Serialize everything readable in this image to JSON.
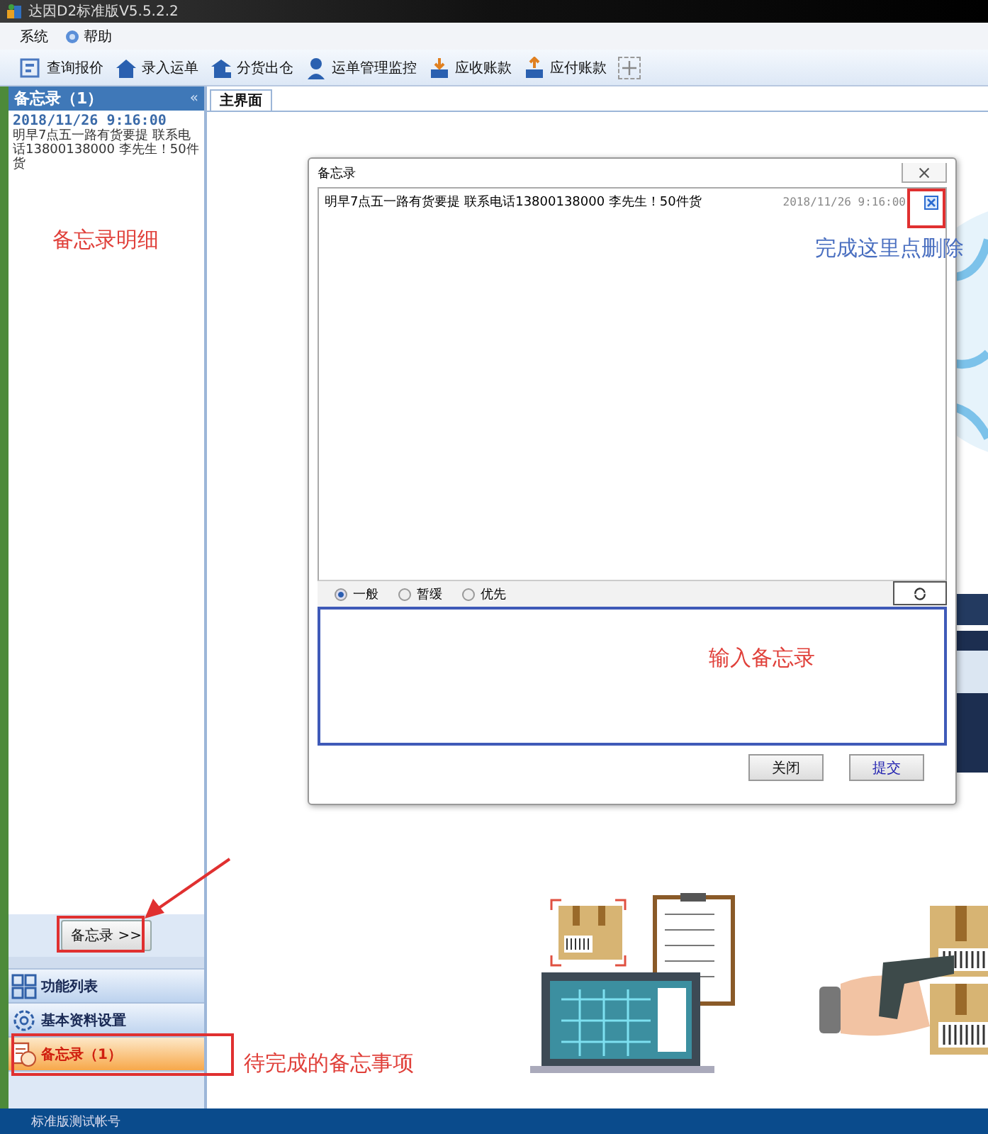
{
  "window": {
    "title": "达因D2标准版V5.5.2.2"
  },
  "menu": [
    {
      "label": "系统",
      "kind": "plain"
    },
    {
      "label": "帮助",
      "kind": "help"
    }
  ],
  "toolbar": [
    {
      "label": "查询报价",
      "kind": "quote"
    },
    {
      "label": "录入运单",
      "kind": "house"
    },
    {
      "label": "分货出仓",
      "kind": "warehouse"
    },
    {
      "label": "运单管理监控",
      "kind": "person"
    },
    {
      "label": "应收账款",
      "kind": "receive"
    },
    {
      "label": "应付账款",
      "kind": "pay"
    }
  ],
  "memo_panel": {
    "title": "备忘录（1）",
    "collapse": "«",
    "entries": [
      {
        "time": "2018/11/26 9:16:00",
        "text": "明早7点五一路有货要提 联系电话13800138000  李先生！50件货"
      }
    ]
  },
  "memo_toggle": "备忘录 >>",
  "nav": [
    {
      "label": "功能列表",
      "kind": "grid",
      "selected": false
    },
    {
      "label": "基本资料设置",
      "kind": "gear",
      "selected": false
    },
    {
      "label": "备忘录（1）",
      "kind": "memo",
      "selected": true
    }
  ],
  "tabs": [
    {
      "label": "主界面",
      "selected": true
    }
  ],
  "dialog": {
    "title": "备忘录",
    "memos": [
      {
        "text": "明早7点五一路有货要提 联系电话13800138000  李先生！50件货",
        "time": "2018/11/26 9:16:00"
      }
    ],
    "priorities": [
      {
        "label": "一般",
        "selected": true
      },
      {
        "label": "暂缓",
        "selected": false
      },
      {
        "label": "优先",
        "selected": false
      }
    ],
    "buttons": [
      {
        "label": "关闭",
        "kind": "close"
      },
      {
        "label": "提交",
        "kind": "submit"
      }
    ]
  },
  "annotations": [
    {
      "text": "备忘录明细",
      "color": "#e0403a"
    },
    {
      "text": "完成这里点删除",
      "color": "#4a6fc0"
    },
    {
      "text": "输入备忘录",
      "color": "#e0403a"
    },
    {
      "text": "待完成的备忘事项",
      "color": "#e0403a"
    }
  ],
  "status_bar": {
    "text": "标准版测试帐号"
  }
}
